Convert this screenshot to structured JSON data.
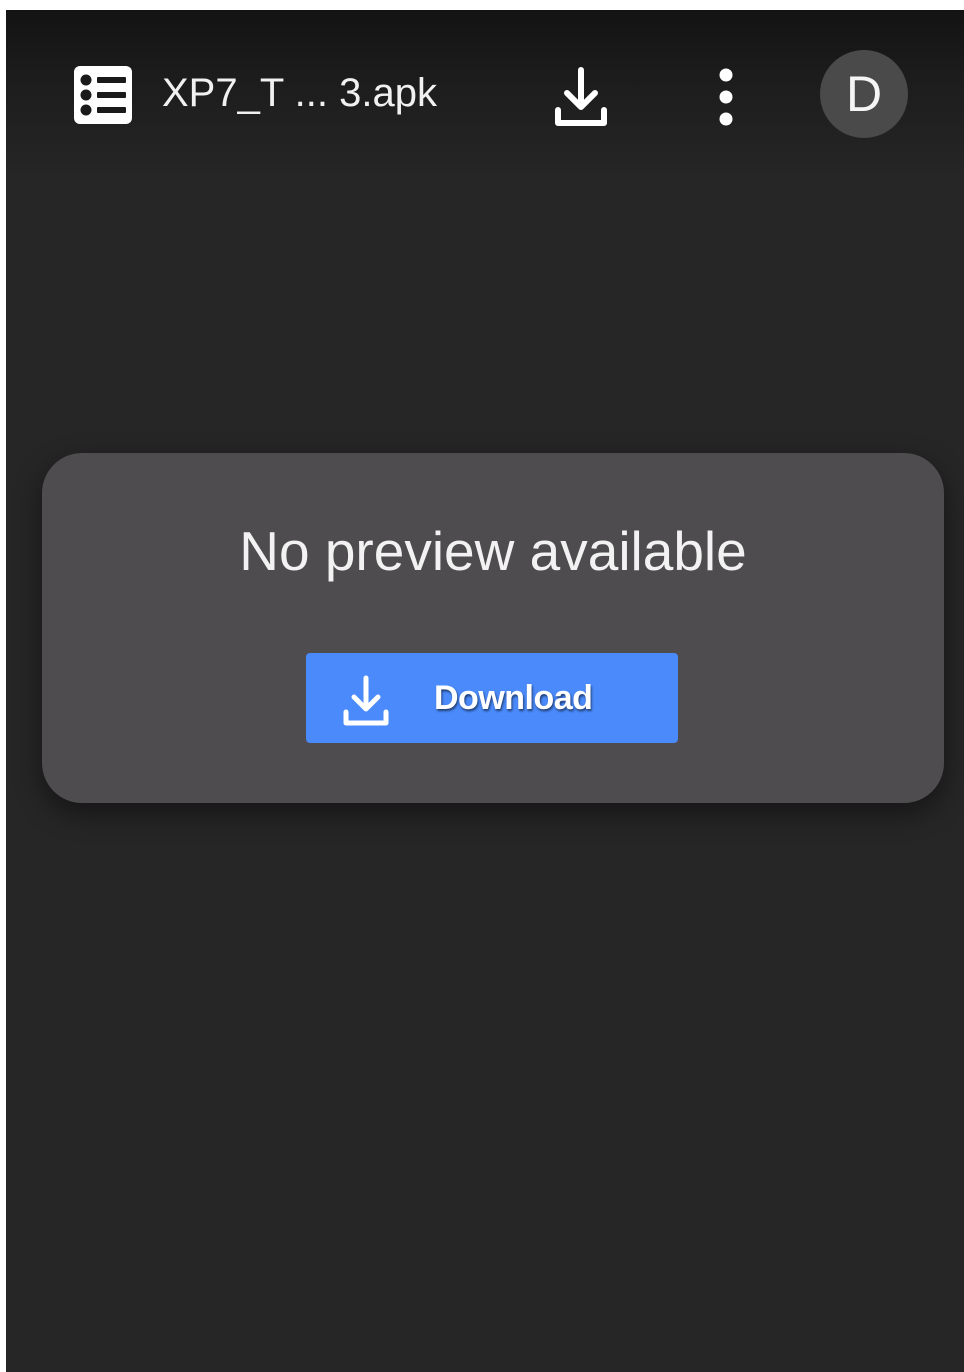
{
  "header": {
    "file_icon": "file-list-icon",
    "file_name": "XP7_T ... 3.apk",
    "download_icon": "download-icon",
    "more_icon": "more-vertical-icon",
    "avatar_letter": "D"
  },
  "preview": {
    "message": "No preview available",
    "download_button_icon": "download-icon",
    "download_button_label": "Download"
  },
  "colors": {
    "background": "#262626",
    "header_top": "#131313",
    "card": "#4e4c4e",
    "accent": "#4a8afb",
    "avatar": "#4a4a4a",
    "text": "#f2f2f2"
  }
}
